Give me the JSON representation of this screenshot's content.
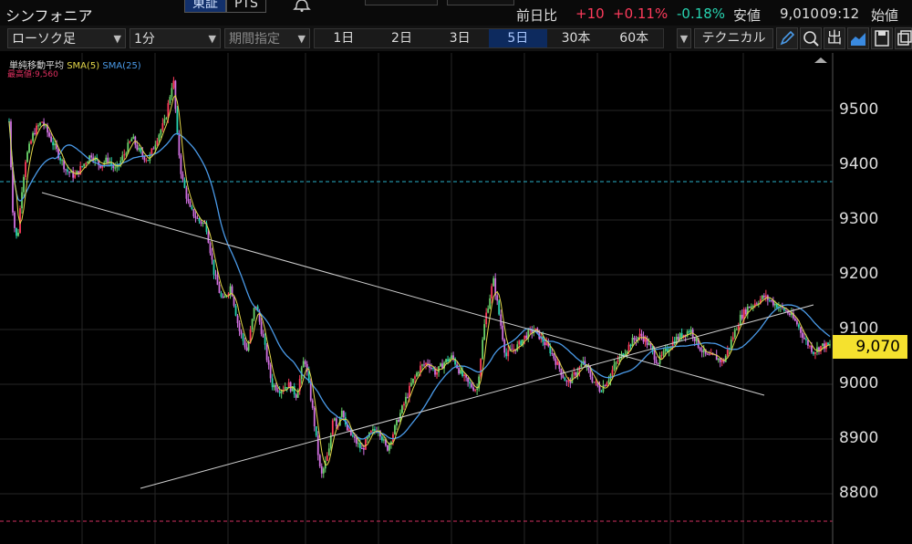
{
  "header": {
    "stock_name": "シンフォニア",
    "market_tabs": [
      "東証",
      "PTS"
    ],
    "market_selected": "東証",
    "bell_icon": "bell-icon",
    "prev_day_label": "前日比",
    "change": "+10",
    "change_pct": "+0.11%",
    "other_pct": "-0.18%",
    "low_label": "安値",
    "low_value": "9,010",
    "time": "09:12",
    "open_label": "始値",
    "colors": {
      "up": "#ff3b5c",
      "down": "#27d3b0"
    }
  },
  "toolbar": {
    "chart_type": "ローソク足",
    "interval": "1分",
    "period_placeholder": "期間指定",
    "periods": [
      "1日",
      "2日",
      "3日",
      "5日",
      "30本",
      "60本"
    ],
    "period_selected": "5日",
    "technical": "テクニカル",
    "icons": [
      "pen-icon",
      "zoom-icon",
      "volume-icon",
      "area-chart-icon",
      "save-icon",
      "copy-icon"
    ],
    "volume_label": "出"
  },
  "chart_data": {
    "type": "line",
    "indicator_title": "単純移動平均",
    "series": [
      {
        "name": "SMA(5)",
        "color": "#e5d84a"
      },
      {
        "name": "SMA(25)",
        "color": "#4a9ae8"
      }
    ],
    "max_label": "最高値:9,560",
    "y_ticks": [
      9500,
      9400,
      9300,
      9200,
      9100,
      9000,
      8900,
      8800
    ],
    "ylim": [
      8780,
      9600
    ],
    "current_price": "9,070",
    "ref_lines": [
      {
        "value": 9370,
        "color": "#2ab0c8"
      },
      {
        "value": 8750,
        "color": "#d03060"
      }
    ],
    "trendlines": [
      {
        "from": [
          0.04,
          9350
        ],
        "to": [
          0.92,
          8980
        ]
      },
      {
        "from": [
          0.16,
          8810
        ],
        "to": [
          0.98,
          9145
        ]
      }
    ],
    "x": [
      0,
      0.005,
      0.01,
      0.015,
      0.02,
      0.03,
      0.04,
      0.05,
      0.06,
      0.07,
      0.08,
      0.09,
      0.1,
      0.11,
      0.12,
      0.13,
      0.14,
      0.15,
      0.16,
      0.17,
      0.18,
      0.19,
      0.2,
      0.205,
      0.21,
      0.22,
      0.23,
      0.24,
      0.25,
      0.26,
      0.27,
      0.28,
      0.29,
      0.3,
      0.31,
      0.32,
      0.33,
      0.34,
      0.35,
      0.36,
      0.37,
      0.38,
      0.39,
      0.395,
      0.4,
      0.405,
      0.41,
      0.42,
      0.43,
      0.44,
      0.45,
      0.46,
      0.47,
      0.48,
      0.49,
      0.5,
      0.51,
      0.52,
      0.53,
      0.54,
      0.55,
      0.56,
      0.57,
      0.58,
      0.59,
      0.6,
      0.605,
      0.61,
      0.62,
      0.63,
      0.64,
      0.65,
      0.66,
      0.67,
      0.68,
      0.69,
      0.7,
      0.71,
      0.72,
      0.73,
      0.74,
      0.75,
      0.76,
      0.77,
      0.78,
      0.79,
      0.8,
      0.81,
      0.82,
      0.83,
      0.84,
      0.85,
      0.86,
      0.87,
      0.88,
      0.89,
      0.9,
      0.91,
      0.92,
      0.93,
      0.94,
      0.95,
      0.96,
      0.97,
      0.98,
      0.99,
      1.0
    ],
    "price": [
      9480,
      9300,
      9260,
      9350,
      9410,
      9460,
      9480,
      9450,
      9420,
      9390,
      9380,
      9400,
      9420,
      9400,
      9410,
      9390,
      9420,
      9450,
      9420,
      9410,
      9450,
      9480,
      9560,
      9450,
      9380,
      9320,
      9300,
      9290,
      9200,
      9150,
      9180,
      9100,
      9060,
      9150,
      9080,
      9000,
      8990,
      9000,
      8980,
      9050,
      8950,
      8830,
      8880,
      8950,
      8920,
      8960,
      8920,
      8900,
      8880,
      8910,
      8920,
      8880,
      8920,
      8960,
      9000,
      9030,
      9040,
      9020,
      9040,
      9050,
      9020,
      9000,
      8990,
      9120,
      9190,
      9100,
      9050,
      9060,
      9070,
      9090,
      9100,
      9080,
      9060,
      9030,
      9000,
      9020,
      9040,
      9010,
      8990,
      9010,
      9040,
      9060,
      9080,
      9090,
      9070,
      9040,
      9060,
      9080,
      9090,
      9100,
      9070,
      9050,
      9050,
      9040,
      9080,
      9120,
      9140,
      9150,
      9160,
      9150,
      9140,
      9130,
      9110,
      9080,
      9060,
      9070,
      9070
    ]
  }
}
